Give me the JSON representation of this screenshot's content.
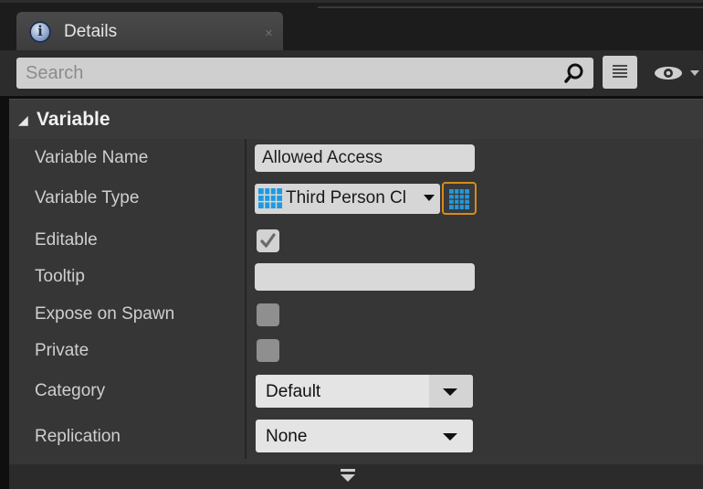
{
  "tab": {
    "title": "Details",
    "close": "×"
  },
  "search": {
    "placeholder": "Search"
  },
  "category": {
    "title": "Variable"
  },
  "properties": {
    "variable_name": {
      "label": "Variable Name",
      "value": "Allowed Access"
    },
    "variable_type": {
      "label": "Variable Type",
      "value": "Third Person Cl"
    },
    "editable": {
      "label": "Editable",
      "checked": true
    },
    "tooltip": {
      "label": "Tooltip",
      "value": ""
    },
    "expose_on_spawn": {
      "label": "Expose on Spawn",
      "checked": false
    },
    "private": {
      "label": "Private",
      "checked": false
    },
    "category": {
      "label": "Category",
      "value": "Default"
    },
    "replication": {
      "label": "Replication",
      "value": "None"
    }
  },
  "icons": {
    "tab": "info-icon",
    "search": "search-icon",
    "grid": "property-matrix-icon",
    "eye": "eye-icon",
    "type": "object-type-icon",
    "container": "container-type-icon",
    "expand": "expand-advanced-icon"
  },
  "colors": {
    "panel_bg": "#363636",
    "header_bg": "#3a3a3a",
    "type_blue": "#1e9ae0",
    "container_border": "#d88a1e"
  }
}
